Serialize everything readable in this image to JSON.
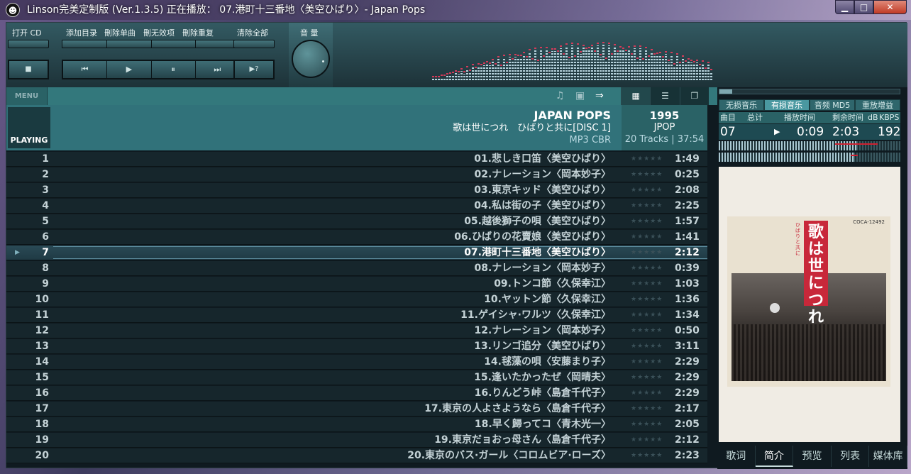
{
  "window": {
    "title": "Linson完美定制版 (Ver.1.3.5)   正在播放： 07.港町十三番地〈美空ひばり〉- Japan Pops",
    "min": "▁",
    "max": "□",
    "close": "✕"
  },
  "controls": {
    "open_cd": "打开 CD",
    "add_dir": "添加目录",
    "del_single": "刪除单曲",
    "del_invalid": "刪无效项",
    "del_dup": "刪除重复",
    "clear_all": "清除全部",
    "volume": "音 量",
    "stop": "■",
    "prev": "⏮",
    "play": "▶",
    "pause": "⏸",
    "next": "⏭",
    "unknown": "▶?"
  },
  "toolbar": {
    "menu": "MENU",
    "views": [
      "▦",
      "☰",
      "❐"
    ]
  },
  "album": {
    "playing_tag": "PLAYING",
    "name": "JAPAN POPS",
    "subtitle": "歌は世につれ　ひばりと共に[DISC 1]",
    "format": "MP3 CBR",
    "year": "1995",
    "genre": "JPOP",
    "tracks_info": "20 Tracks | 37:54"
  },
  "tracks": [
    {
      "n": "1",
      "title": "01.悲しき口笛〈美空ひばり〉",
      "dur": "1:49"
    },
    {
      "n": "2",
      "title": "02.ナレーション〈岡本妙子〉",
      "dur": "0:25"
    },
    {
      "n": "3",
      "title": "03.東京キッド〈美空ひばり〉",
      "dur": "2:08"
    },
    {
      "n": "4",
      "title": "04.私は街の子〈美空ひばり〉",
      "dur": "2:25"
    },
    {
      "n": "5",
      "title": "05.越後獅子の唄〈美空ひばり〉",
      "dur": "1:57"
    },
    {
      "n": "6",
      "title": "06.ひばりの花賣娘〈美空ひばり〉",
      "dur": "1:41"
    },
    {
      "n": "7",
      "title": "07.港町十三番地〈美空ひばり〉",
      "dur": "2:12"
    },
    {
      "n": "8",
      "title": "08.ナレーション〈岡本妙子〉",
      "dur": "0:39"
    },
    {
      "n": "9",
      "title": "09.トンコ節〈久保幸江〉",
      "dur": "1:03"
    },
    {
      "n": "10",
      "title": "10.ヤットン節〈久保幸江〉",
      "dur": "1:36"
    },
    {
      "n": "11",
      "title": "11.ゲイシャ·ワルツ〈久保幸江〉",
      "dur": "1:34"
    },
    {
      "n": "12",
      "title": "12.ナレーション〈岡本妙子〉",
      "dur": "0:50"
    },
    {
      "n": "13",
      "title": "13.リンゴ追分〈美空ひばり〉",
      "dur": "3:11"
    },
    {
      "n": "14",
      "title": "14.毬藻の唄〈安藤まり子〉",
      "dur": "2:29"
    },
    {
      "n": "15",
      "title": "15.逢いたかったぜ〈岡晴夫〉",
      "dur": "2:29"
    },
    {
      "n": "16",
      "title": "16.りんどう峠〈島倉千代子〉",
      "dur": "2:29"
    },
    {
      "n": "17",
      "title": "17.東京の人よさようなら〈島倉千代子〉",
      "dur": "2:17"
    },
    {
      "n": "18",
      "title": "18.早く歸ってコ〈青木光一〉",
      "dur": "2:05"
    },
    {
      "n": "19",
      "title": "19.東京だョおっ母さん〈島倉千代子〉",
      "dur": "2:12"
    },
    {
      "n": "20",
      "title": "20.東京のバス·ガール〈コロムビア·ローズ〉",
      "dur": "2:23"
    }
  ],
  "playing_index": 6,
  "stars_glyph": "★★★★★",
  "right": {
    "type_tabs": [
      "无损音乐",
      "有损音乐",
      "音频 MD5",
      "重放增益"
    ],
    "active_type": 1,
    "labels": {
      "track": "曲目",
      "total": "总计",
      "played": "播放时间",
      "remaining": "剩余时间",
      "db": "dB",
      "kbps": "KBPS"
    },
    "values": {
      "track": "07",
      "play_icon": "▶",
      "played": "0:09",
      "remaining": "2:03",
      "kbps": "192"
    },
    "seek_progress": 0.07,
    "cover": {
      "title": "歌は世につれ",
      "sub": "ひばりと共に",
      "catalog": "COCA-12492"
    },
    "bottom_tabs": [
      "歌词",
      "简介",
      "预览",
      "列表",
      "媒体库"
    ],
    "active_bottom": 1
  }
}
